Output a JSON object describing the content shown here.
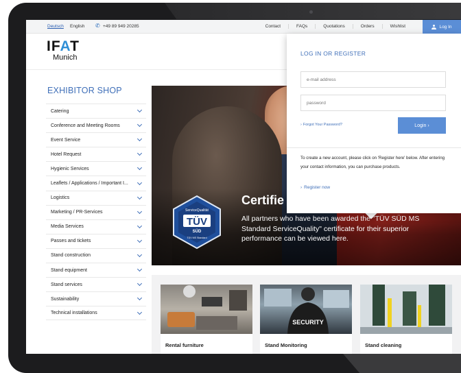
{
  "topbar": {
    "lang_de": "Deutsch",
    "lang_en": "English",
    "phone": "+49 89 949 20285",
    "links": [
      "Contact",
      "FAQs",
      "Quotations",
      "Orders",
      "Wishlist"
    ],
    "login_label": "Log In"
  },
  "logo": {
    "main_pre": "IF",
    "main_a": "A",
    "main_post": "T",
    "sub": "Munich"
  },
  "sidebar": {
    "title": "EXHIBITOR SHOP",
    "items": [
      "Catering",
      "Conference and Meeting Rooms",
      "Event Service",
      "Hotel Request",
      "Hygienic Services",
      "Leaflets / Applications / Important I...",
      "Logistics",
      "Marketing / PR-Services",
      "Media Services",
      "Passes and tickets",
      "Stand construction",
      "Stand equipment",
      "Stand services",
      "Sustainability",
      "Technical installations"
    ]
  },
  "hero": {
    "title": "Certifie",
    "text": "All partners who have been awarded the \"TÜV SÜD MS Standard ServiceQuality\" certificate for their superior performance can be viewed here.",
    "badge_top": "ServiceQualität",
    "badge_main": "TÜV",
    "badge_sud": "SÜD",
    "badge_bottom": "TÜV MS Standard"
  },
  "cards": [
    {
      "title": "Rental furniture"
    },
    {
      "title": "Stand Monitoring",
      "img_text": "SECURITY"
    },
    {
      "title": "Stand cleaning"
    }
  ],
  "login_dropdown": {
    "title": "LOG IN OR REGISTER",
    "email_placeholder": "e-mail address",
    "password_placeholder": "password",
    "forgot_label": "Forgot Your Password?",
    "login_button": "Login",
    "info_text": "To create a new account, please click on 'Register here' below. After entering your contact information, you can purchase products.",
    "register_label": "Register now"
  },
  "colors": {
    "accent": "#3f6fb8",
    "button": "#5b8ed6",
    "hero_red": "#c0261f"
  }
}
